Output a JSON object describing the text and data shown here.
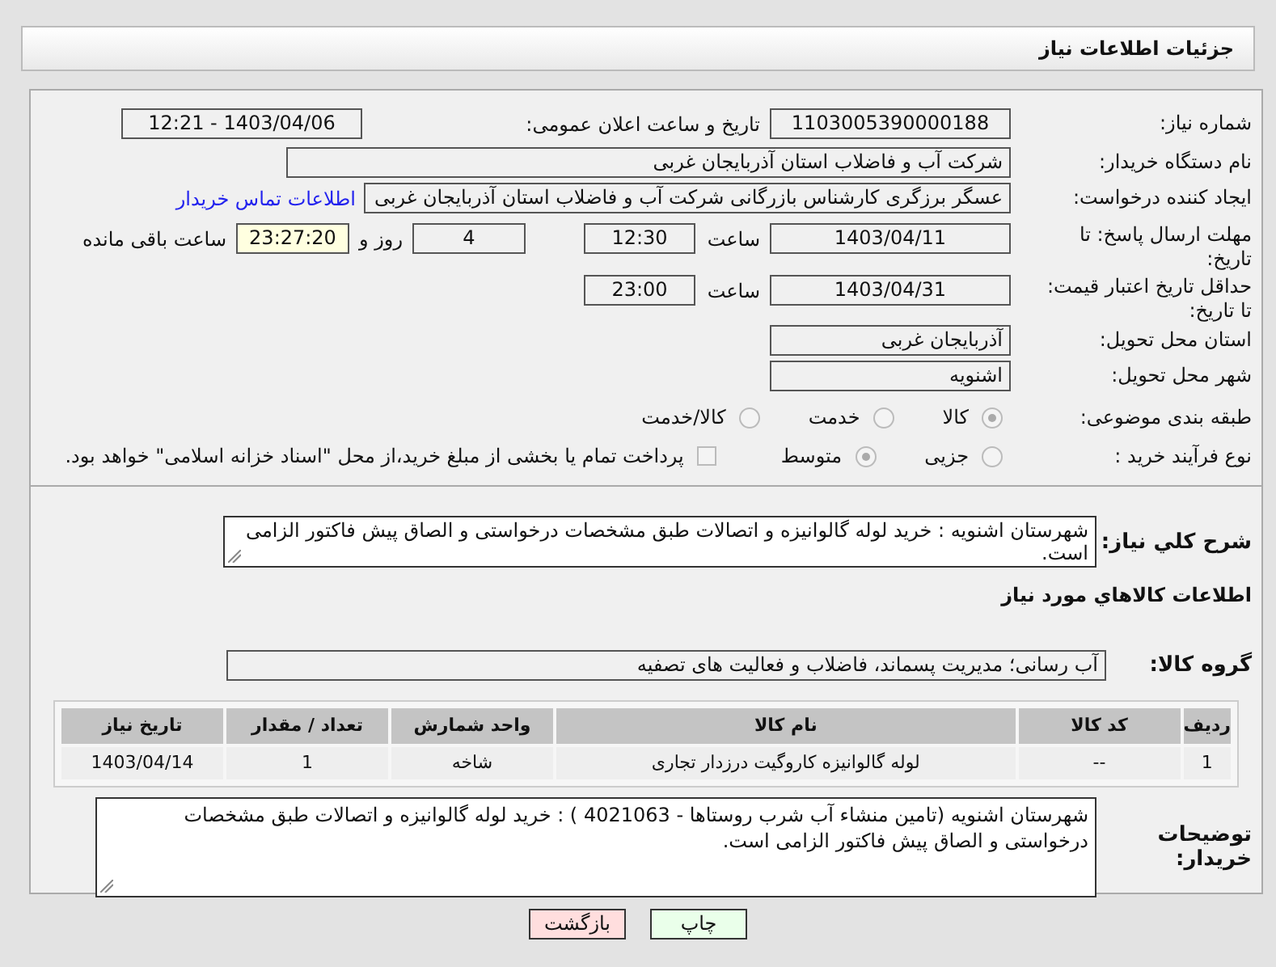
{
  "header": {
    "title": "جزئیات اطلاعات نیاز"
  },
  "need_number": {
    "label": "شماره نیاز:",
    "value": "1103005390000188"
  },
  "announce_datetime": {
    "label": "تاریخ و ساعت اعلان عمومی:",
    "value": "1403/04/06 - 12:21"
  },
  "buyer_org": {
    "label": "نام دستگاه خریدار:",
    "value": "شرکت آب و فاضلاب استان آذربایجان غربی"
  },
  "requester": {
    "label": "ایجاد کننده درخواست:",
    "value": "عسگر  برزگری کارشناس بازرگانی شرکت آب و فاضلاب استان آذربایجان غربی",
    "contact_link": "اطلاعات تماس خریدار"
  },
  "response_deadline": {
    "label": "مهلت ارسال پاسخ: تا تاریخ:",
    "date": "1403/04/11",
    "time_label": "ساعت",
    "time": "12:30",
    "days": "4",
    "days_label": "روز و",
    "remaining": "23:27:20",
    "remaining_label": "ساعت باقی مانده"
  },
  "price_validity": {
    "label": "حداقل تاریخ اعتبار قیمت: تا تاریخ:",
    "date": "1403/04/31",
    "time_label": "ساعت",
    "time": "23:00"
  },
  "delivery_province": {
    "label": "استان محل تحویل:",
    "value": "آذربایجان غربی"
  },
  "delivery_city": {
    "label": "شهر محل تحویل:",
    "value": "اشنویه"
  },
  "category": {
    "label": "طبقه بندی موضوعی:",
    "options": [
      {
        "label": "کالا",
        "selected": true
      },
      {
        "label": "خدمت",
        "selected": false
      },
      {
        "label": "کالا/خدمت",
        "selected": false
      }
    ]
  },
  "purchase_process": {
    "label": "نوع فرآیند خرید :",
    "options": [
      {
        "label": "جزیی",
        "selected": false
      },
      {
        "label": "متوسط",
        "selected": true
      }
    ],
    "payment_note": {
      "label": "پرداخت تمام یا بخشی از مبلغ خرید،از محل \"اسناد خزانه اسلامی\" خواهد بود.",
      "checked": false
    }
  },
  "description": {
    "label": "شرح کلي نياز:",
    "value": "شهرستان اشنویه  : خرید  لوله گالوانیزه و اتصالات   طبق مشخصات درخواستی و الصاق پیش فاکتور الزامی است."
  },
  "goods_section_title": "اطلاعات کالاهاي مورد نياز",
  "goods_group": {
    "label": "گروه کالا:",
    "value": "آب رسانی؛ مدیریت پسماند، فاضلاب و فعالیت های تصفیه"
  },
  "table": {
    "columns": [
      "ردیف",
      "کد کالا",
      "نام کالا",
      "واحد شمارش",
      "تعداد / مقدار",
      "تاریخ نیاز"
    ],
    "rows": [
      [
        "1",
        "--",
        "لوله گالوانیزه کاروگیت درزدار تجاری",
        "شاخه",
        "1",
        "1403/04/14"
      ]
    ]
  },
  "buyer_notes": {
    "label": "توضیحات خریدار:",
    "value": "شهرستان اشنویه (تامین منشاء آب شرب روستاها - 4021063 ) : خرید  لوله گالوانیزه و اتصالات   طبق مشخصات درخواستی و الصاق پیش فاکتور الزامی است."
  },
  "buttons": [
    {
      "label": "چاپ",
      "kind": "print"
    },
    {
      "label": "بازگشت",
      "kind": "back"
    }
  ]
}
